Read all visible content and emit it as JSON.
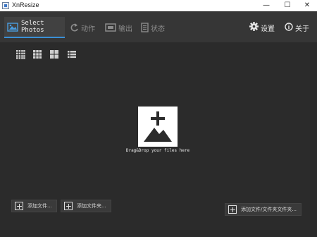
{
  "window": {
    "title": "XnResize",
    "minimize_glyph": "—",
    "maximize_glyph": "☐",
    "close_glyph": "✕"
  },
  "toolbar": {
    "tabs": [
      {
        "label": "Select Photos",
        "icon": "photo-select-icon",
        "active": true
      },
      {
        "label": "动作",
        "icon": "rotate-icon",
        "active": false
      },
      {
        "label": "输出",
        "icon": "output-icon",
        "active": false
      },
      {
        "label": "状态",
        "icon": "status-list-icon",
        "active": false
      }
    ],
    "settings_label": "设置",
    "settings_icon": "gear-icon",
    "about_label": "关于",
    "about_icon": "info-icon"
  },
  "view_modes": [
    {
      "icon": "grid-small-icon"
    },
    {
      "icon": "grid-medium-icon"
    },
    {
      "icon": "grid-large-icon"
    },
    {
      "icon": "list-view-icon"
    }
  ],
  "drop_zone": {
    "text": "Drag&Drop your files here",
    "icon": "add-photo-icon"
  },
  "buttons": {
    "add_files": "添加文件...",
    "add_folder": "添加文件夹...",
    "add_files_folder": "添加文件/文件夹文件夹..."
  },
  "colors": {
    "background": "#2b2b2b",
    "toolbar": "#363636",
    "accent": "#3a8fd6"
  }
}
